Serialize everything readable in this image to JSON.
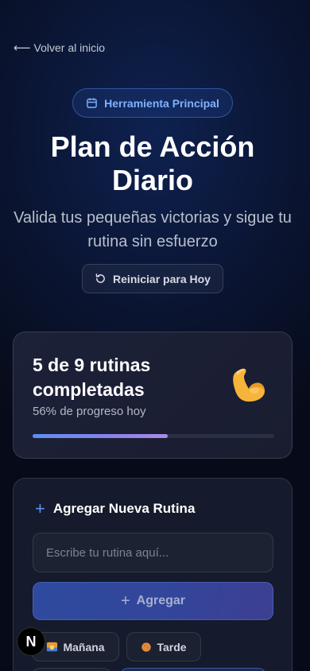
{
  "nav": {
    "back_label": "Volver al inicio",
    "back_arrow": "⟵"
  },
  "badge": {
    "label": "Herramienta Principal",
    "icon": "calendar-icon"
  },
  "header": {
    "title_line1": "Plan de Acción",
    "title_line2": "Diario",
    "subtitle": "Valida tus pequeñas victorias y sigue tu rutina sin esfuerzo"
  },
  "reset": {
    "label": "Reiniciar para Hoy",
    "icon": "refresh-icon"
  },
  "progress": {
    "title": "5 de 9 rutinas completadas",
    "subtitle": "56% de progreso hoy",
    "completed": 5,
    "total": 9,
    "percent": 56,
    "emoji": "flexed-biceps"
  },
  "add_routine": {
    "heading": "Agregar Nueva Rutina",
    "input_placeholder": "Escribe tu rutina aquí...",
    "input_value": "",
    "button_label": "Agregar"
  },
  "time_filters": [
    {
      "label": "Mañana",
      "icon": "sunrise-icon"
    },
    {
      "label": "Tarde",
      "icon": "orange-circle-icon"
    }
  ],
  "dev_badge": {
    "letter": "N"
  },
  "colors": {
    "accent": "#5a90f5",
    "badge_text": "#7fb1ff",
    "background": "#070b19"
  }
}
